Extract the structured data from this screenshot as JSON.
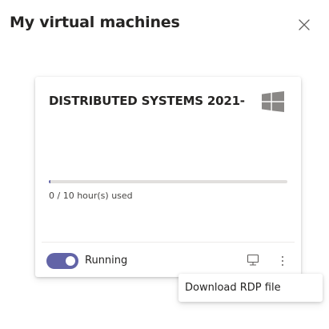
{
  "panel": {
    "title": "My virtual machines",
    "close_icon": "close-icon"
  },
  "vm": {
    "name": "DISTRIBUTED SYSTEMS 2021-",
    "os_icon": "windows-icon",
    "usage": {
      "used_hours": 0,
      "total_hours": 10,
      "fraction_used": 0,
      "text": "0 / 10 hour(s) used"
    },
    "status": {
      "toggle_on": true,
      "label": "Running"
    },
    "actions": {
      "connect_icon": "monitor-icon",
      "more_icon": "more-vertical-icon"
    }
  },
  "menu": {
    "items": [
      {
        "label": "Download RDP file"
      }
    ]
  },
  "colors": {
    "accent": "#6264a7",
    "text": "#252423",
    "muted_text": "#484644",
    "icon_gray": "#8a8886",
    "track": "#e1dfdd"
  }
}
